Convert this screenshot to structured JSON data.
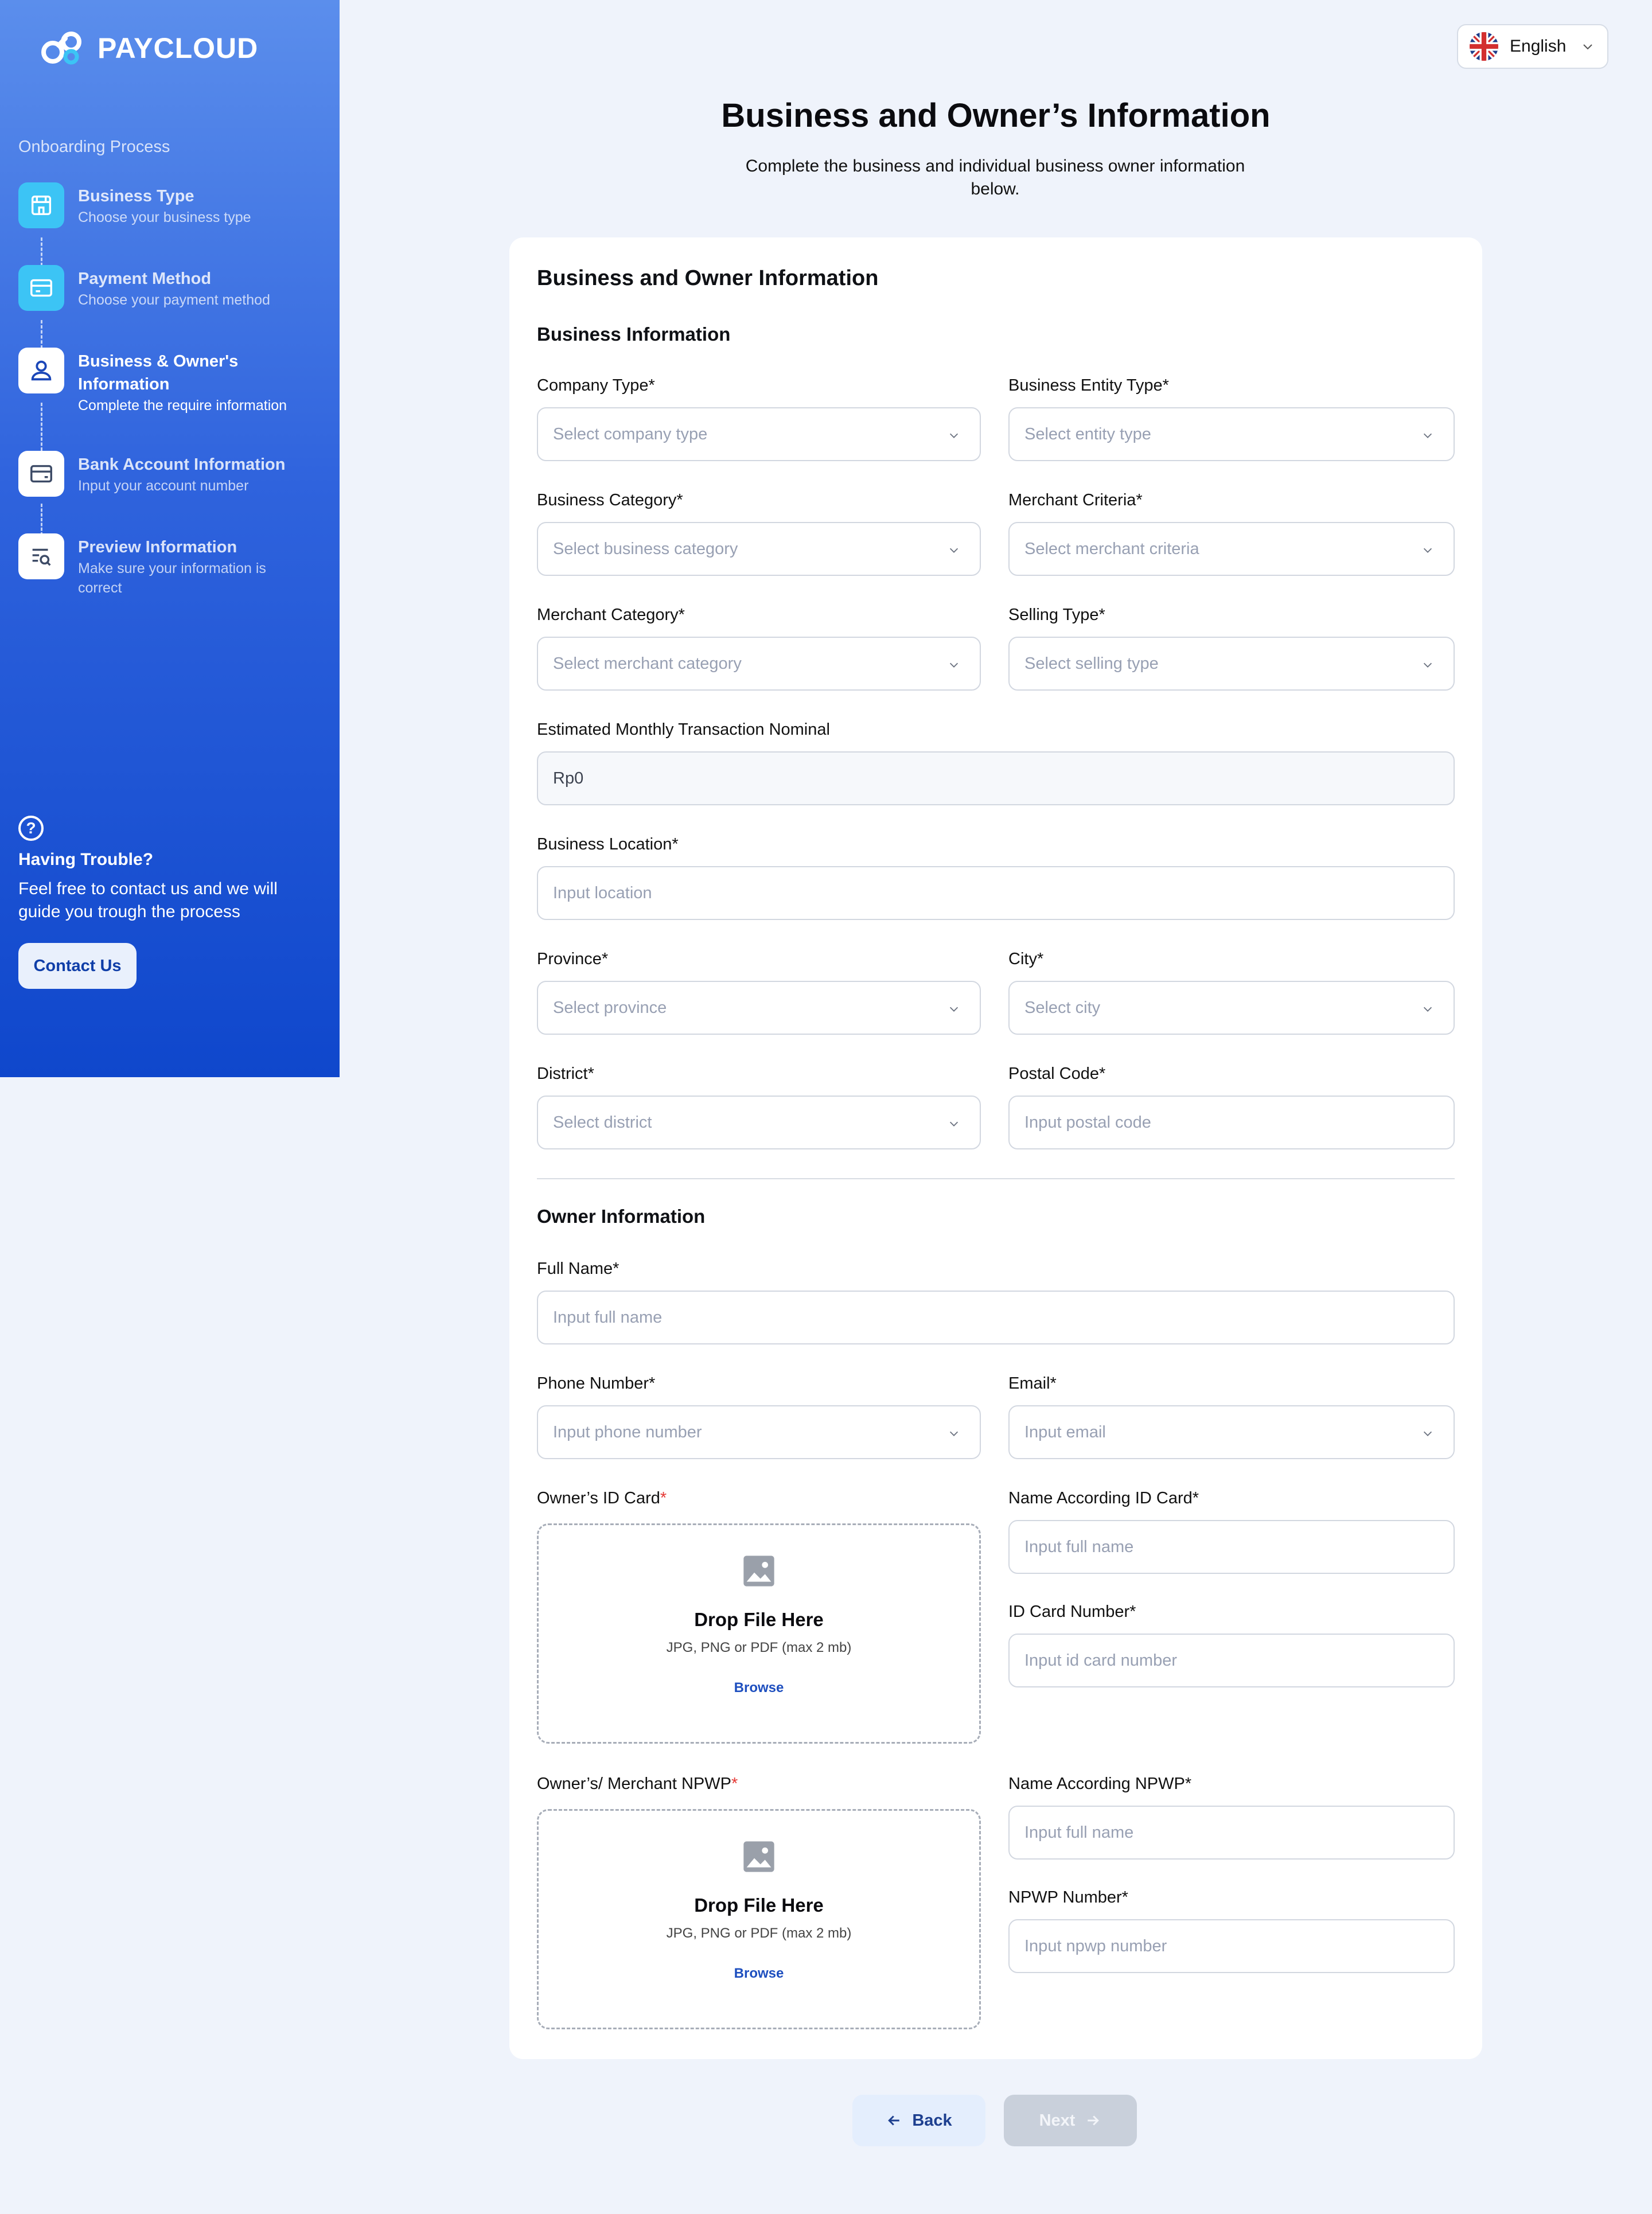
{
  "app": {
    "logo_text": "PAYCLOUD"
  },
  "language": {
    "label": "English",
    "icon": "uk-flag-icon"
  },
  "sidebar": {
    "title": "Onboarding Process",
    "steps": [
      {
        "name": "Business Type",
        "desc": "Choose your business type",
        "icon": "store-icon",
        "state": "done"
      },
      {
        "name": "Payment Method",
        "desc": "Choose your payment method",
        "icon": "card-icon",
        "state": "done"
      },
      {
        "name": "Business & Owner's Information",
        "desc": "Complete the require information",
        "icon": "user-icon",
        "state": "active"
      },
      {
        "name": "Bank Account Information",
        "desc": "Input your account number",
        "icon": "wallet-icon",
        "state": "todo"
      },
      {
        "name": "Preview Information",
        "desc": "Make sure your information is correct",
        "icon": "list-search-icon",
        "state": "todo"
      }
    ],
    "help": {
      "title": "Having Trouble?",
      "desc": "Feel free to contact us and we will guide you trough the process",
      "button": "Contact Us"
    }
  },
  "header": {
    "title": "Business and Owner’s Information",
    "subtitle": "Complete the business and individual business owner information below."
  },
  "form": {
    "title": "Business and Owner Information",
    "business_section": "Business Information",
    "company_type": {
      "label": "Company Type*",
      "placeholder": "Select company type"
    },
    "entity_type": {
      "label": "Business Entity Type*",
      "placeholder": "Select entity type"
    },
    "business_category": {
      "label": "Business Category*",
      "placeholder": "Select business category"
    },
    "merchant_criteria": {
      "label": "Merchant Criteria*",
      "placeholder": "Select merchant criteria"
    },
    "merchant_category": {
      "label": "Merchant Category*",
      "placeholder": "Select merchant category"
    },
    "selling_type": {
      "label": "Selling Type*",
      "placeholder": "Select selling type"
    },
    "monthly_nominal": {
      "label": "Estimated Monthly Transaction Nominal",
      "value": "Rp0"
    },
    "location": {
      "label": "Business Location*",
      "placeholder": "Input location"
    },
    "province": {
      "label": "Province*",
      "placeholder": "Select province"
    },
    "city": {
      "label": "City*",
      "placeholder": "Select city"
    },
    "district": {
      "label": "District*",
      "placeholder": "Select district"
    },
    "postal_code": {
      "label": "Postal Code*",
      "placeholder": "Input postal code"
    },
    "owner_section": "Owner Information",
    "full_name": {
      "label": "Full Name*",
      "placeholder": "Input full name"
    },
    "phone": {
      "label": "Phone Number*",
      "placeholder": "Input phone number"
    },
    "email": {
      "label": "Email*",
      "placeholder": "Input email"
    },
    "id_card": {
      "label": "Owner’s ID Card",
      "req": "*"
    },
    "id_name": {
      "label": "Name According ID Card*",
      "placeholder": "Input full name"
    },
    "id_number": {
      "label": "ID Card Number*",
      "placeholder": "Input id card number"
    },
    "npwp": {
      "label": "Owner’s/ Merchant NPWP",
      "req": "*"
    },
    "npwp_name": {
      "label": "Name According NPWP*",
      "placeholder": "Input full name"
    },
    "npwp_number": {
      "label": "NPWP Number*",
      "placeholder": "Input npwp number"
    },
    "dropzone": {
      "title": "Drop File Here",
      "hint": "JPG, PNG or PDF (max 2 mb)",
      "browse": "Browse"
    }
  },
  "actions": {
    "back": "Back",
    "next": "Next"
  },
  "colors": {
    "brand_blue": "#2F63DD",
    "done_step": "#3CC4F5",
    "required": "#E53935",
    "link": "#1E4FBF"
  }
}
